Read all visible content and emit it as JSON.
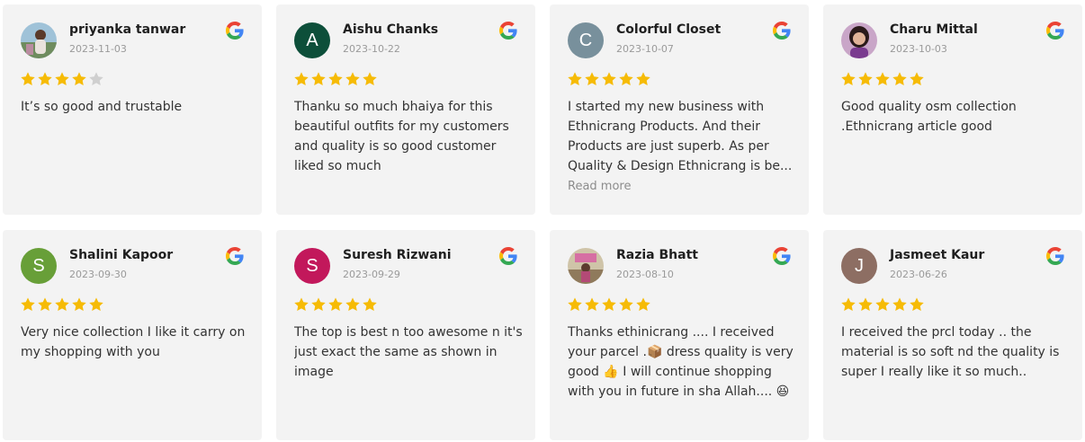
{
  "reviews": [
    {
      "name": "priyanka tanwar",
      "date": "2023-11-03",
      "rating": 4,
      "avatar_type": "photo",
      "avatar_letter": "",
      "text": "It’s so good and trustable",
      "read_more": ""
    },
    {
      "name": "Aishu Chanks",
      "date": "2023-10-22",
      "rating": 5,
      "avatar_type": "letter",
      "avatar_letter": "A",
      "avatar_color": "#0d4f3a",
      "text": "Thanku so much bhaiya for this beautiful outfits for my customers and quality is so good customer liked so much",
      "read_more": ""
    },
    {
      "name": "Colorful Closet",
      "date": "2023-10-07",
      "rating": 5,
      "avatar_type": "letter",
      "avatar_letter": "C",
      "avatar_color": "#78909c",
      "text": "I started my new business with Ethnicrang Products. And their Products are just superb. As per Quality & Design Ethnicrang is be...",
      "read_more": "Read more"
    },
    {
      "name": "Charu Mittal",
      "date": "2023-10-03",
      "rating": 5,
      "avatar_type": "photo",
      "avatar_letter": "",
      "text": "Good quality osm collection .Ethnicrang article good",
      "read_more": ""
    },
    {
      "name": "Shalini Kapoor",
      "date": "2023-09-30",
      "rating": 5,
      "avatar_type": "letter",
      "avatar_letter": "S",
      "avatar_color": "#689f38",
      "text": "Very nice collection I like it carry on my shopping with you",
      "read_more": ""
    },
    {
      "name": "Suresh Rizwani",
      "date": "2023-09-29",
      "rating": 5,
      "avatar_type": "letter",
      "avatar_letter": "S",
      "avatar_color": "#c2185b",
      "text": "The top is best n too awesome n it's just exact the same as shown in image",
      "read_more": ""
    },
    {
      "name": "Razia Bhatt",
      "date": "2023-08-10",
      "rating": 5,
      "avatar_type": "photo",
      "avatar_letter": "",
      "text": "Thanks ethinicrang .... I received your parcel .📦 dress quality is very good 👍 I will continue shopping with you in future in sha Allah.... 😆",
      "read_more": ""
    },
    {
      "name": "Jasmeet Kaur",
      "date": "2023-06-26",
      "rating": 5,
      "avatar_type": "letter",
      "avatar_letter": "J",
      "avatar_color": "#8d6e63",
      "text": "I received the prcl today .. the material is so soft nd the quality is super I really like it so much..",
      "read_more": ""
    }
  ],
  "colors": {
    "card_bg": "#f3f3f3",
    "star_filled": "#f6bb06",
    "star_empty": "#cfcfcf"
  },
  "icons": {
    "source": "google-g-icon",
    "rating": "star-icon"
  }
}
